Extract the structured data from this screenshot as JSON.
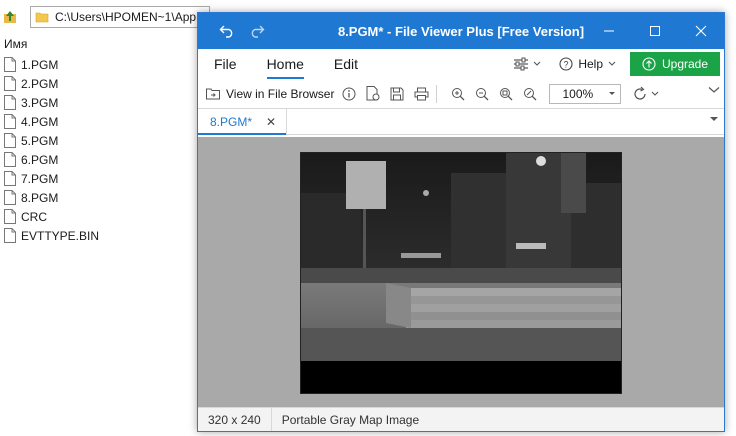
{
  "explorer": {
    "address_path": "C:\\Users\\HPOMEN~1\\AppI",
    "column_header": "Имя",
    "files": [
      {
        "name": "1.PGM"
      },
      {
        "name": "2.PGM"
      },
      {
        "name": "3.PGM"
      },
      {
        "name": "4.PGM"
      },
      {
        "name": "5.PGM"
      },
      {
        "name": "6.PGM"
      },
      {
        "name": "7.PGM"
      },
      {
        "name": "8.PGM"
      },
      {
        "name": "CRC"
      },
      {
        "name": "EVTTYPE.BIN"
      }
    ]
  },
  "viewer": {
    "window_title": "8.PGM* - File Viewer Plus [Free Version]",
    "menu_tabs": [
      "File",
      "Home",
      "Edit"
    ],
    "active_tab": "Home",
    "help_label": "Help",
    "upgrade_label": "Upgrade",
    "view_in_file_browser_label": "View in File Browser",
    "zoom_value": "100%",
    "document_tab": "8.PGM*",
    "status": {
      "dimensions": "320 x 240",
      "file_type": "Portable Gray Map Image"
    },
    "colors": {
      "titlebar": "#1f78d1",
      "upgrade": "#1ba347",
      "canvas_bg": "#a9a9a9"
    }
  }
}
